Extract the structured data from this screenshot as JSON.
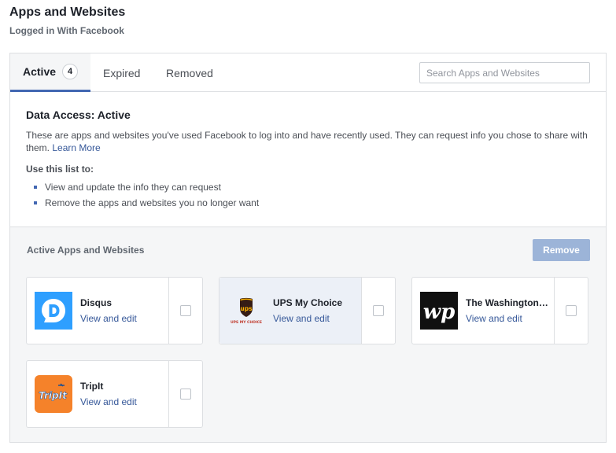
{
  "header": {
    "title": "Apps and Websites",
    "subtitle": "Logged in With Facebook"
  },
  "tabs": [
    {
      "label": "Active",
      "count": "4",
      "active": true
    },
    {
      "label": "Expired",
      "active": false
    },
    {
      "label": "Removed",
      "active": false
    }
  ],
  "search": {
    "placeholder": "Search Apps and Websites",
    "value": ""
  },
  "info": {
    "title": "Data Access: Active",
    "description": "These are apps and websites you've used Facebook to log into and have recently used. They can request info you chose to share with them.",
    "learn_more": "Learn More",
    "use_title": "Use this list to:",
    "use_items": [
      "View and update the info they can request",
      "Remove the apps and websites you no longer want"
    ]
  },
  "apps_section": {
    "heading": "Active Apps and Websites",
    "remove_label": "Remove",
    "apps": [
      {
        "name": "Disqus",
        "action": "View and edit",
        "icon": "disqus-logo-icon"
      },
      {
        "name": "UPS My Choice",
        "action": "View and edit",
        "icon": "ups-logo-icon",
        "logo_text": "ups",
        "logo_caption": "UPS MY CHOICE"
      },
      {
        "name": "The Washington Post",
        "action": "View and edit",
        "icon": "washington-post-logo-icon",
        "logo_text": "wp"
      },
      {
        "name": "TripIt",
        "action": "View and edit",
        "icon": "tripit-logo-icon",
        "logo_text": "TripIt"
      }
    ]
  },
  "colors": {
    "accent": "#4267b2",
    "link": "#365899",
    "remove_disabled": "#9cb4d8",
    "disqus": "#2e9fff",
    "tripit": "#f5822a",
    "ups_brown": "#351c15",
    "ups_gold": "#ffb500"
  }
}
